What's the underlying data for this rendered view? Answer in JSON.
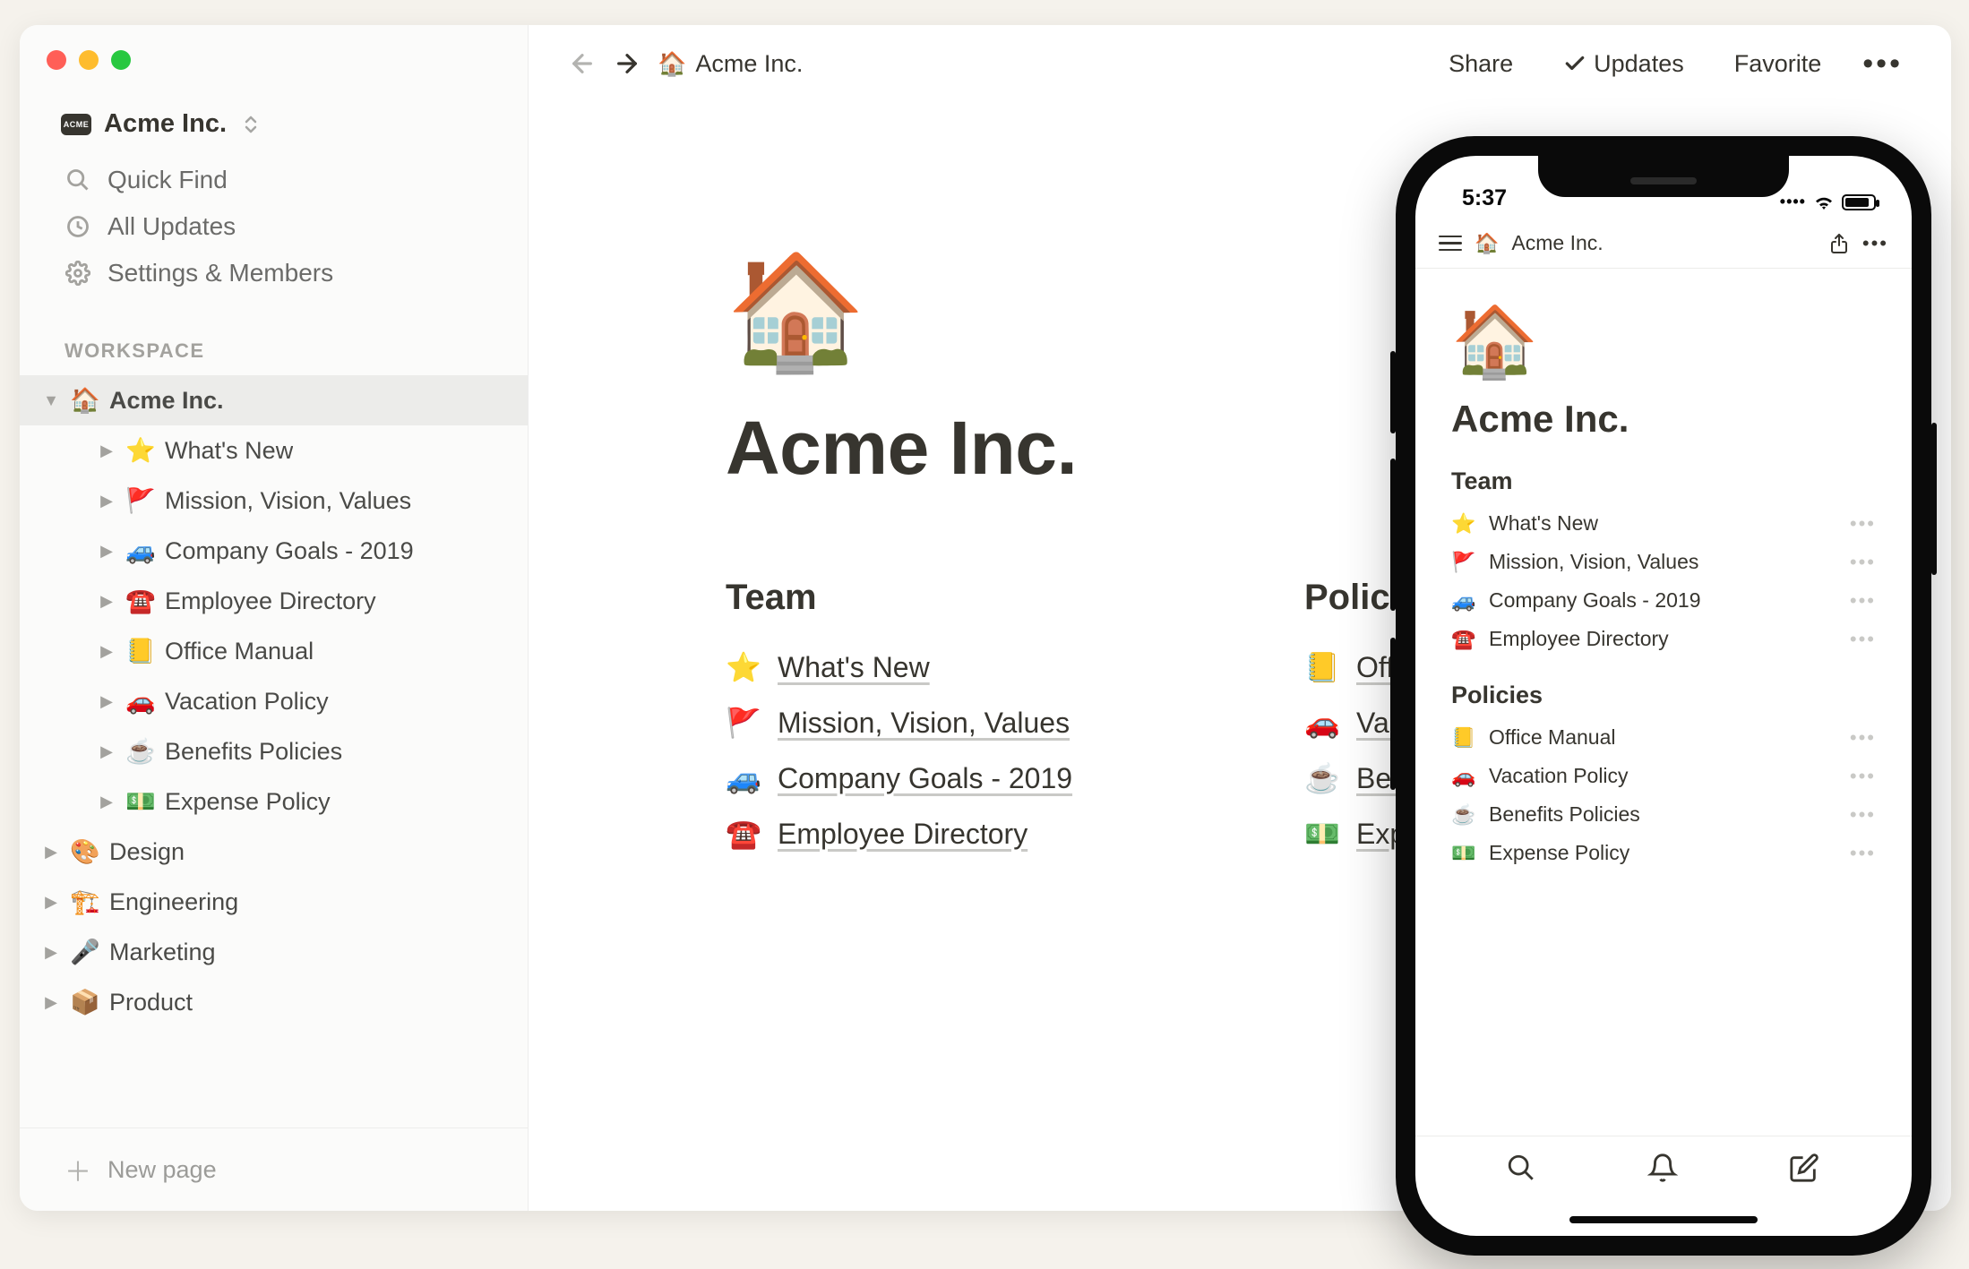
{
  "workspace": {
    "name": "Acme Inc.",
    "icon_label": "ACME"
  },
  "sidebar": {
    "nav": {
      "quick_find": "Quick Find",
      "all_updates": "All Updates",
      "settings_members": "Settings & Members"
    },
    "section_label": "WORKSPACE",
    "tree": {
      "root": {
        "emoji": "🏠",
        "label": "Acme Inc."
      },
      "children": [
        {
          "emoji": "⭐",
          "label": "What's New"
        },
        {
          "emoji": "🚩",
          "label": "Mission, Vision, Values"
        },
        {
          "emoji": "🚙",
          "label": "Company Goals - 2019"
        },
        {
          "emoji": "☎️",
          "label": "Employee Directory"
        },
        {
          "emoji": "📒",
          "label": "Office Manual"
        },
        {
          "emoji": "🚗",
          "label": "Vacation Policy"
        },
        {
          "emoji": "☕",
          "label": "Benefits Policies"
        },
        {
          "emoji": "💵",
          "label": "Expense Policy"
        }
      ],
      "siblings": [
        {
          "emoji": "🎨",
          "label": "Design"
        },
        {
          "emoji": "🏗️",
          "label": "Engineering"
        },
        {
          "emoji": "🎤",
          "label": "Marketing"
        },
        {
          "emoji": "📦",
          "label": "Product"
        }
      ]
    },
    "new_page": "New page"
  },
  "topbar": {
    "breadcrumb": {
      "emoji": "🏠",
      "label": "Acme Inc."
    },
    "share": "Share",
    "updates": "Updates",
    "favorite": "Favorite"
  },
  "page": {
    "hero_emoji": "🏠",
    "title": "Acme Inc.",
    "columns": [
      {
        "heading": "Team",
        "links": [
          {
            "emoji": "⭐",
            "label": "What's New"
          },
          {
            "emoji": "🚩",
            "label": "Mission, Vision, Values"
          },
          {
            "emoji": "🚙",
            "label": "Company Goals - 2019"
          },
          {
            "emoji": "☎️",
            "label": "Employee Directory"
          }
        ]
      },
      {
        "heading": "Policies",
        "links": [
          {
            "emoji": "📒",
            "label": "Office Manual"
          },
          {
            "emoji": "🚗",
            "label": "Vacation Policy"
          },
          {
            "emoji": "☕",
            "label": "Benefits Policies"
          },
          {
            "emoji": "💵",
            "label": "Expense Policy"
          }
        ]
      }
    ]
  },
  "mobile": {
    "time": "5:37",
    "breadcrumb": {
      "emoji": "🏠",
      "label": "Acme Inc."
    },
    "hero_emoji": "🏠",
    "title": "Acme Inc.",
    "sections": [
      {
        "heading": "Team",
        "links": [
          {
            "emoji": "⭐",
            "label": "What's New"
          },
          {
            "emoji": "🚩",
            "label": "Mission, Vision, Values"
          },
          {
            "emoji": "🚙",
            "label": "Company Goals - 2019"
          },
          {
            "emoji": "☎️",
            "label": "Employee Directory"
          }
        ]
      },
      {
        "heading": "Policies",
        "links": [
          {
            "emoji": "📒",
            "label": "Office Manual"
          },
          {
            "emoji": "🚗",
            "label": "Vacation Policy"
          },
          {
            "emoji": "☕",
            "label": "Benefits Policies"
          },
          {
            "emoji": "💵",
            "label": "Expense Policy"
          }
        ]
      }
    ]
  }
}
